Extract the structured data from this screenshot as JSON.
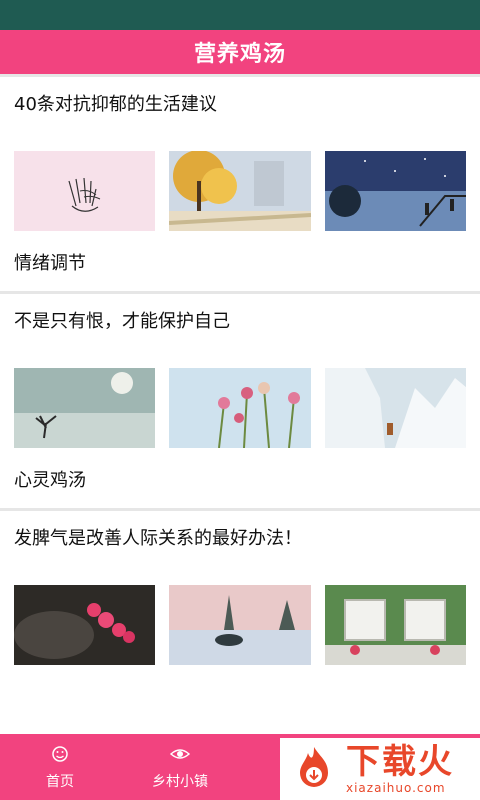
{
  "header": {
    "title": "营养鸡汤"
  },
  "cards": [
    {
      "title": "40条对抗抑郁的生活建议"
    },
    {
      "title": "不是只有恨，才能保护自己"
    },
    {
      "title": "发脾气是改善人际关系的最好办法！"
    }
  ],
  "sections": [
    {
      "title": "情绪调节"
    },
    {
      "title": "心灵鸡汤"
    }
  ],
  "bottom_nav": [
    {
      "label": "首页",
      "icon": "smile-icon"
    },
    {
      "label": "乡村小镇",
      "icon": "eye-icon"
    }
  ],
  "watermark": {
    "main": "下载火",
    "sub": "xiazaihuo.com"
  },
  "colors": {
    "accent": "#f2437f",
    "status_bar": "#1f5b52",
    "divider": "#e6e6e6",
    "watermark": "#e8472a"
  }
}
